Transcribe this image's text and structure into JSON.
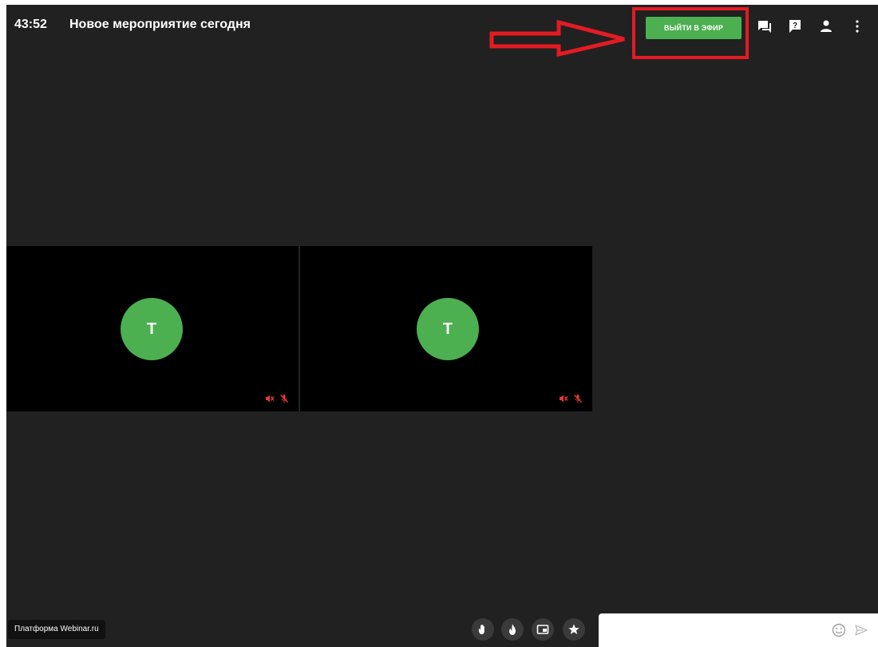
{
  "header": {
    "timer": "43:52",
    "event_title": "Новое мероприятие сегодня",
    "go_live_label": "ВЫЙТИ В ЭФИР",
    "icons": [
      "chat-icon",
      "help-icon",
      "participants-icon",
      "more-vertical-icon"
    ]
  },
  "annotation": {
    "color": "#e31b23"
  },
  "tiles": [
    {
      "initial": "T",
      "icons": [
        "speaker-muted-icon",
        "mic-muted-icon"
      ]
    },
    {
      "initial": "T",
      "icons": [
        "speaker-muted-icon",
        "mic-muted-icon"
      ]
    }
  ],
  "footer": {
    "platform_label": "Платформа Webinar.ru",
    "controls": [
      "raise-hand-icon",
      "fire-reaction-icon",
      "picture-in-picture-icon",
      "star-icon"
    ],
    "chat_placeholder": "",
    "chat_icons": [
      "emoji-icon",
      "send-icon"
    ]
  },
  "colors": {
    "background": "#212121",
    "tile": "#000000",
    "accent_green": "#4caf50",
    "muted_red": "#e53935"
  }
}
